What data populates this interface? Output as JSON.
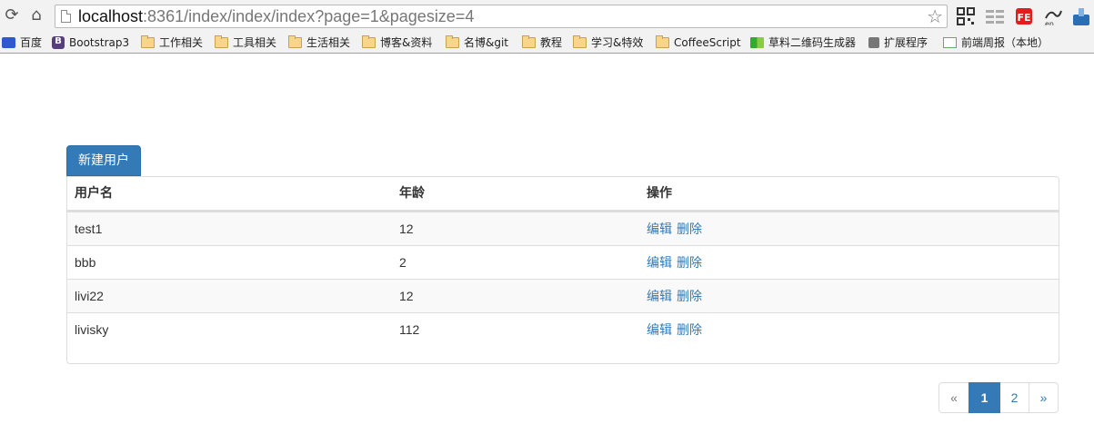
{
  "browser": {
    "address": {
      "host": "localhost",
      "path": ":8361/index/index/index?page=1&pagesize=4"
    },
    "bookmarks": [
      {
        "label": "百度",
        "icon": "baidu-icon"
      },
      {
        "label": "Bootstrap3",
        "icon": "bootstrap-icon"
      },
      {
        "label": "工作相关",
        "icon": "folder-icon"
      },
      {
        "label": "工具相关",
        "icon": "folder-icon"
      },
      {
        "label": "生活相关",
        "icon": "folder-icon"
      },
      {
        "label": "博客&资料",
        "icon": "folder-icon"
      },
      {
        "label": "名博&git",
        "icon": "folder-icon"
      },
      {
        "label": "教程",
        "icon": "folder-icon"
      },
      {
        "label": "学习&特效",
        "icon": "folder-icon"
      },
      {
        "label": "CoffeeScript",
        "icon": "folder-icon"
      },
      {
        "label": "草料二维码生成器",
        "icon": "qrcode-icon"
      },
      {
        "label": "扩展程序",
        "icon": "puzzle-icon"
      },
      {
        "label": "前端周报（本地）",
        "icon": "document-icon"
      }
    ]
  },
  "page": {
    "new_user_label": "新建用户",
    "table": {
      "headers": [
        "用户名",
        "年龄",
        "操作"
      ],
      "rows": [
        {
          "name": "test1",
          "age": "12",
          "edit": "编辑",
          "delete": "删除"
        },
        {
          "name": "bbb",
          "age": "2",
          "edit": "编辑",
          "delete": "删除"
        },
        {
          "name": "livi22",
          "age": "12",
          "edit": "编辑",
          "delete": "删除"
        },
        {
          "name": "livisky",
          "age": "112",
          "edit": "编辑",
          "delete": "删除"
        }
      ]
    },
    "pagination": {
      "prev": "«",
      "pages": [
        "1",
        "2"
      ],
      "current": "1",
      "next": "»"
    }
  },
  "colors": {
    "primary": "#337ab7",
    "border": "#dddddd",
    "stripe": "#f9f9f9"
  }
}
